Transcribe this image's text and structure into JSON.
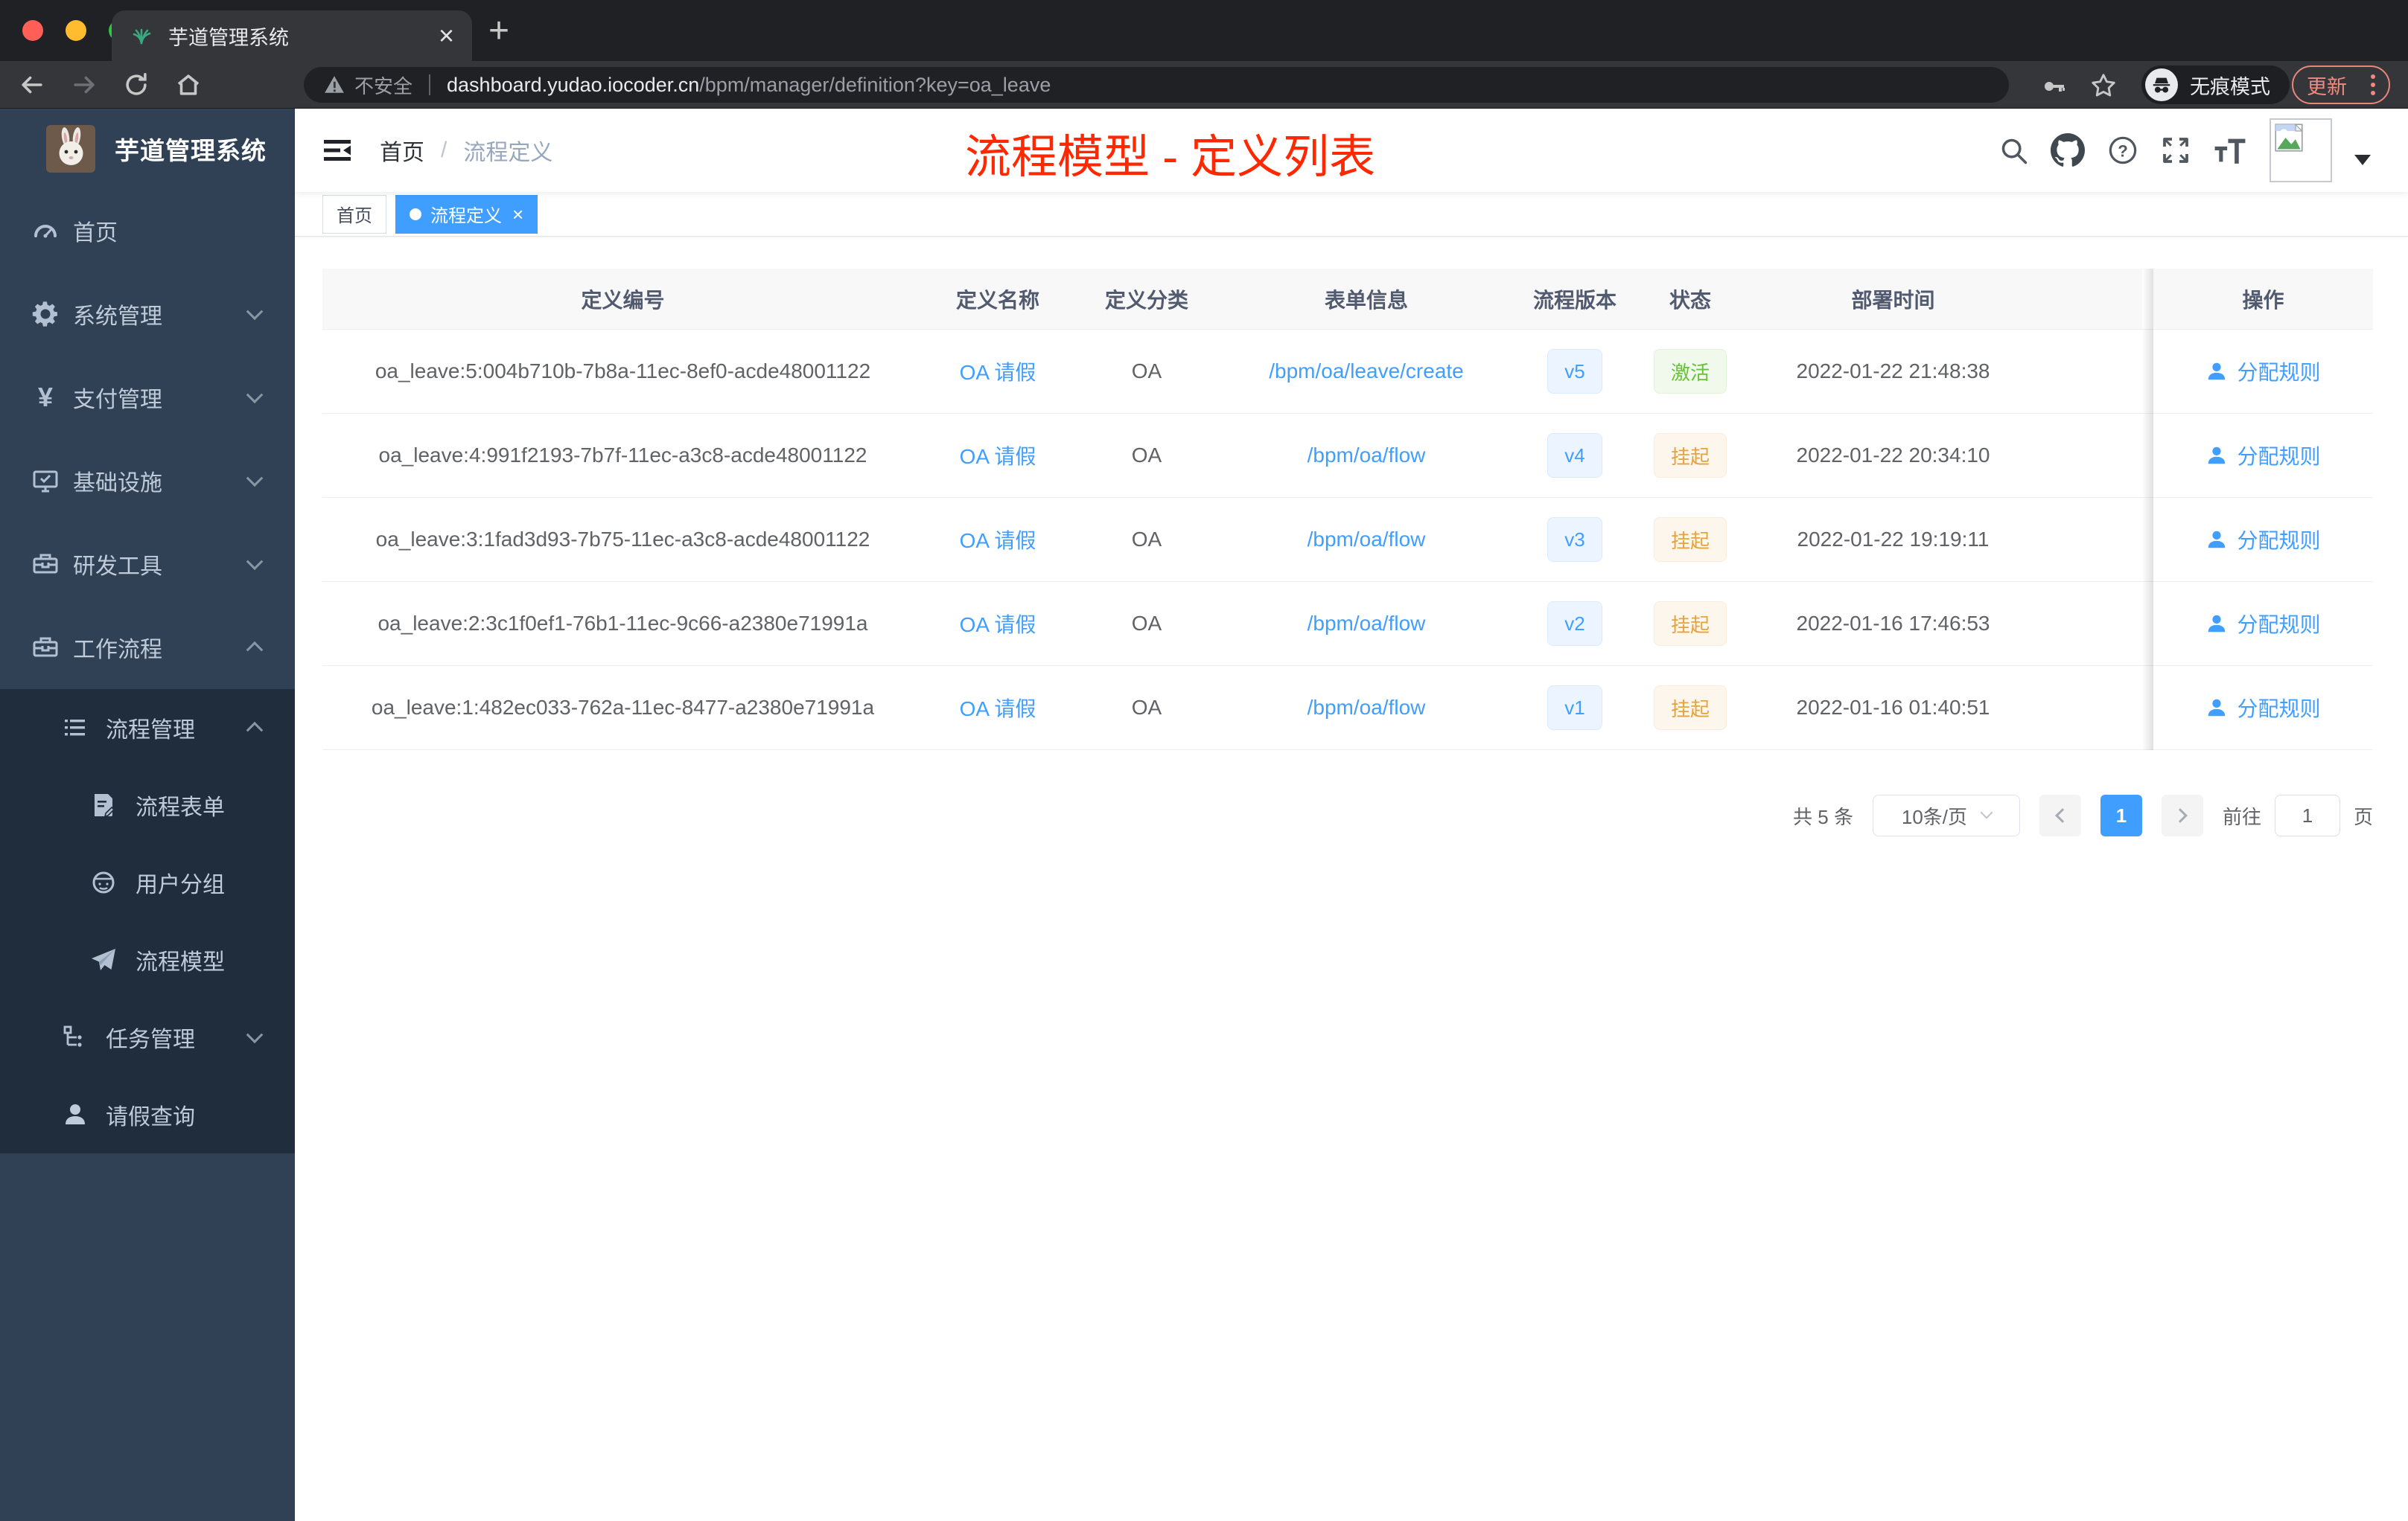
{
  "glyphs": {
    "close": "×",
    "plus": "+",
    "question": "?",
    "yen": "¥"
  },
  "colors": {
    "primary": "#409eff",
    "sidebar_bg": "#304156",
    "submenu_bg": "#1f2d3d",
    "annotation_red": "#ff2800",
    "status_active": "#67c23a",
    "status_suspended": "#e6a23c",
    "chrome_dark": "#202124",
    "header_row_bg": "#f8f8f9"
  },
  "browser": {
    "tab_title": "芋道管理系统",
    "security_label": "不安全",
    "url_host": "dashboard.yudao.iocoder.cn",
    "url_path": "/bpm/manager/definition?key=oa_leave",
    "incognito_label": "无痕模式",
    "update_label": "更新"
  },
  "sidebar": {
    "logo_title": "芋道管理系统",
    "items": [
      {
        "label": "首页",
        "icon": "dashboard-icon"
      },
      {
        "label": "系统管理",
        "icon": "gear-icon"
      },
      {
        "label": "支付管理",
        "icon": "yen-icon"
      },
      {
        "label": "基础设施",
        "icon": "monitor-icon"
      },
      {
        "label": "研发工具",
        "icon": "toolbox-icon"
      },
      {
        "label": "工作流程",
        "icon": "briefcase-icon"
      },
      {
        "label": "流程管理",
        "icon": "list-icon"
      },
      {
        "label": "流程表单",
        "icon": "form-icon"
      },
      {
        "label": "用户分组",
        "icon": "user-group-icon"
      },
      {
        "label": "流程模型",
        "icon": "paper-plane-icon"
      },
      {
        "label": "任务管理",
        "icon": "task-tree-icon"
      },
      {
        "label": "请假查询",
        "icon": "person-icon"
      }
    ]
  },
  "navbar": {
    "breadcrumb_home": "首页",
    "separator": "/",
    "breadcrumb_current": "流程定义",
    "annotation": "流程模型 - 定义列表"
  },
  "tags": {
    "items": [
      {
        "label": "首页",
        "active": false
      },
      {
        "label": "流程定义",
        "active": true
      }
    ]
  },
  "table": {
    "columns": [
      "定义编号",
      "定义名称",
      "定义分类",
      "表单信息",
      "流程版本",
      "状态",
      "部署时间",
      "操作"
    ],
    "rows": [
      {
        "id": "oa_leave:5:004b710b-7b8a-11ec-8ef0-acde48001122",
        "name": "OA 请假",
        "category": "OA",
        "form": "/bpm/oa/leave/create",
        "version": "v5",
        "status": "激活",
        "status_class": "ok",
        "time": "2022-01-22 21:48:38",
        "action": "分配规则"
      },
      {
        "id": "oa_leave:4:991f2193-7b7f-11ec-a3c8-acde48001122",
        "name": "OA 请假",
        "category": "OA",
        "form": "/bpm/oa/flow",
        "version": "v4",
        "status": "挂起",
        "status_class": "warn",
        "time": "2022-01-22 20:34:10",
        "action": "分配规则"
      },
      {
        "id": "oa_leave:3:1fad3d93-7b75-11ec-a3c8-acde48001122",
        "name": "OA 请假",
        "category": "OA",
        "form": "/bpm/oa/flow",
        "version": "v3",
        "status": "挂起",
        "status_class": "warn",
        "time": "2022-01-22 19:19:11",
        "action": "分配规则"
      },
      {
        "id": "oa_leave:2:3c1f0ef1-76b1-11ec-9c66-a2380e71991a",
        "name": "OA 请假",
        "category": "OA",
        "form": "/bpm/oa/flow",
        "version": "v2",
        "status": "挂起",
        "status_class": "warn",
        "time": "2022-01-16 17:46:53",
        "action": "分配规则"
      },
      {
        "id": "oa_leave:1:482ec033-762a-11ec-8477-a2380e71991a",
        "name": "OA 请假",
        "category": "OA",
        "form": "/bpm/oa/flow",
        "version": "v1",
        "status": "挂起",
        "status_class": "warn",
        "time": "2022-01-16 01:40:51",
        "action": "分配规则"
      }
    ]
  },
  "pagination": {
    "total": "共 5 条",
    "page_size": "10条/页",
    "current_page": "1",
    "goto_label": "前往",
    "goto_value": "1",
    "goto_unit": "页"
  }
}
